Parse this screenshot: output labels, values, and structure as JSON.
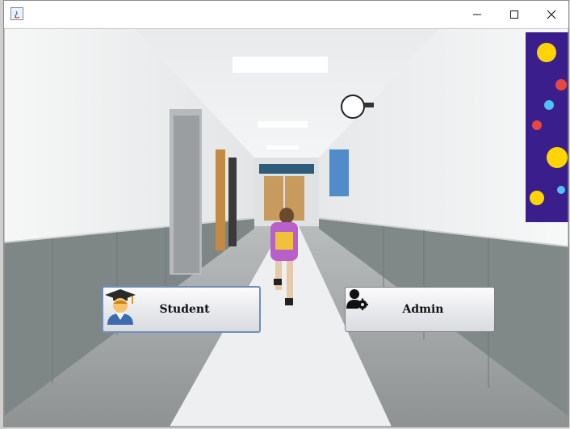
{
  "window": {
    "title": "",
    "controls": [
      "minimize",
      "maximize",
      "close"
    ]
  },
  "buttons": {
    "student": {
      "label": "Student",
      "icon": "graduate-icon"
    },
    "admin": {
      "label": "Admin",
      "icon": "admin-gear-icon"
    }
  },
  "background": {
    "description_icon": "school-hallway-photo"
  },
  "colors": {
    "button_focus_border": "#6f8fb8",
    "button_border": "#7d7f85"
  }
}
